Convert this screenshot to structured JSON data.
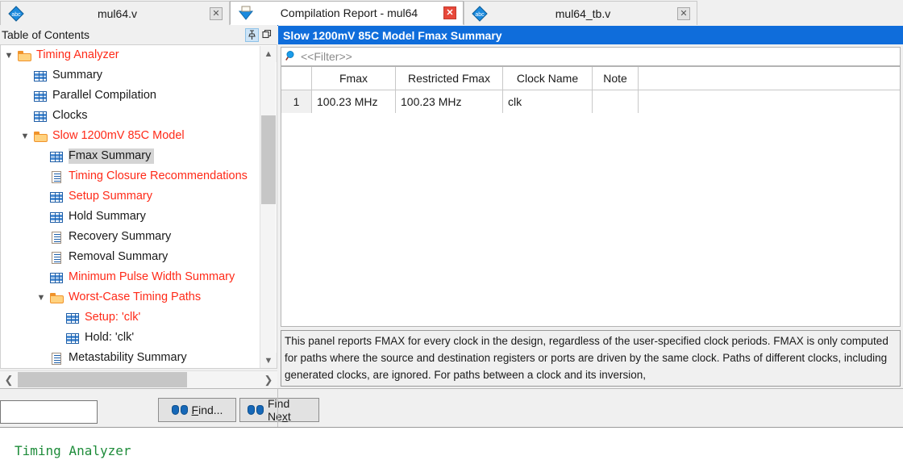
{
  "tabs": [
    {
      "label": "mul64.v",
      "icon": "verilog-file-icon",
      "active": false,
      "close_style": "gray"
    },
    {
      "label": "Compilation Report - mul64",
      "icon": "report-icon",
      "active": true,
      "close_style": "red"
    },
    {
      "label": "mul64_tb.v",
      "icon": "verilog-file-icon",
      "active": false,
      "close_style": "gray"
    }
  ],
  "toc": {
    "title": "Table of Contents",
    "pin_icon": "pin-icon",
    "restore_icon": "restore-window-icon",
    "items": [
      {
        "label": "Timing Analyzer",
        "icon": "folder-icon",
        "indent": 0,
        "chevron": "down",
        "color": "red",
        "selected": false
      },
      {
        "label": "Summary",
        "icon": "grid-icon",
        "indent": 1,
        "chevron": "",
        "color": "black",
        "selected": false
      },
      {
        "label": "Parallel Compilation",
        "icon": "grid-icon",
        "indent": 1,
        "chevron": "",
        "color": "black",
        "selected": false
      },
      {
        "label": "Clocks",
        "icon": "grid-icon",
        "indent": 1,
        "chevron": "",
        "color": "black",
        "selected": false
      },
      {
        "label": "Slow 1200mV 85C Model",
        "icon": "folder-icon",
        "indent": 1,
        "chevron": "down",
        "color": "red",
        "selected": false
      },
      {
        "label": "Fmax Summary",
        "icon": "grid-icon",
        "indent": 2,
        "chevron": "",
        "color": "black",
        "selected": true
      },
      {
        "label": "Timing Closure Recommendations",
        "icon": "doc-icon",
        "indent": 2,
        "chevron": "",
        "color": "red",
        "selected": false
      },
      {
        "label": "Setup Summary",
        "icon": "grid-icon",
        "indent": 2,
        "chevron": "",
        "color": "red",
        "selected": false
      },
      {
        "label": "Hold Summary",
        "icon": "grid-icon",
        "indent": 2,
        "chevron": "",
        "color": "black",
        "selected": false
      },
      {
        "label": "Recovery Summary",
        "icon": "doc-icon",
        "indent": 2,
        "chevron": "",
        "color": "black",
        "selected": false
      },
      {
        "label": "Removal Summary",
        "icon": "doc-icon",
        "indent": 2,
        "chevron": "",
        "color": "black",
        "selected": false
      },
      {
        "label": "Minimum Pulse Width Summary",
        "icon": "grid-icon",
        "indent": 2,
        "chevron": "",
        "color": "red",
        "selected": false
      },
      {
        "label": "Worst-Case Timing Paths",
        "icon": "folder-icon",
        "indent": 2,
        "chevron": "down",
        "color": "red",
        "selected": false
      },
      {
        "label": "Setup: 'clk'",
        "icon": "grid-icon",
        "indent": 3,
        "chevron": "",
        "color": "red",
        "selected": false
      },
      {
        "label": "Hold: 'clk'",
        "icon": "grid-icon",
        "indent": 3,
        "chevron": "",
        "color": "black",
        "selected": false
      },
      {
        "label": "Metastability Summary",
        "icon": "doc-icon",
        "indent": 2,
        "chevron": "",
        "color": "black",
        "selected": false
      }
    ]
  },
  "report": {
    "title": "Slow 1200mV 85C Model Fmax Summary",
    "filter": {
      "icon": "search-icon",
      "placeholder": "<<Filter>>",
      "value": "<<Filter>>"
    },
    "table": {
      "columns": [
        "",
        "Fmax",
        "Restricted Fmax",
        "Clock Name",
        "Note"
      ],
      "rows": [
        {
          "index": "1",
          "fmax": "100.23 MHz",
          "restricted_fmax": "100.23 MHz",
          "clock_name": "clk",
          "note": ""
        }
      ]
    },
    "description": "This panel reports FMAX for every clock in the design, regardless of the user-specified clock periods.  FMAX is only computed for paths where the source and destination registers or ports are driven by the same clock.  Paths of different clocks, including generated clocks, are ignored.  For paths between a clock and its inversion,"
  },
  "findbar": {
    "search_value": "",
    "search_placeholder": "",
    "find_label": "Find...",
    "find_next_label": "Find Next",
    "binoculars_icon": "binoculars-icon"
  },
  "footer": {
    "text": "Timing Analyzer"
  },
  "colors": {
    "title_bar_blue": "#0f6ddb",
    "tree_red": "#ff2a18",
    "selection_gray": "#d4d4d4",
    "footer_green": "#1e8c3a",
    "close_red": "#e8483a"
  }
}
